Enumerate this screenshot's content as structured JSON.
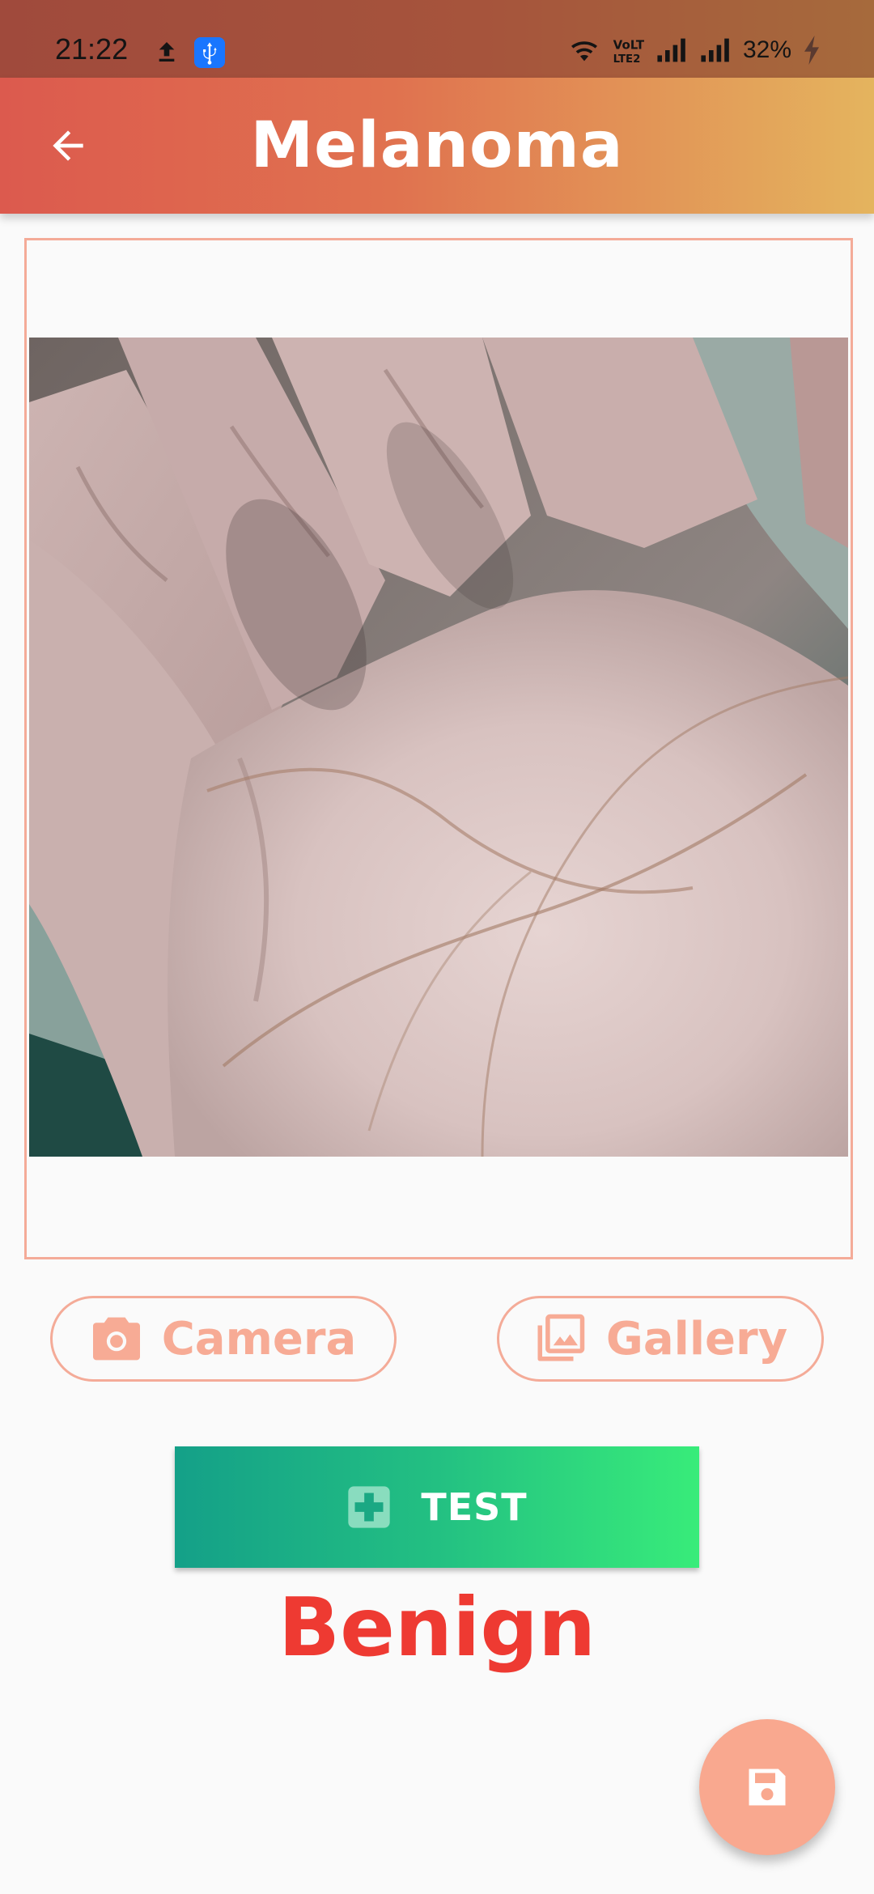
{
  "status_bar": {
    "time": "21:22",
    "battery": "32%",
    "icons": [
      "upload-icon",
      "usb-icon",
      "wifi-icon",
      "volte-icon",
      "signal-icon",
      "signal-icon",
      "charging-icon"
    ]
  },
  "app_bar": {
    "title": "Melanoma",
    "back_icon": "arrow-back-icon"
  },
  "actions": {
    "camera_label": "Camera",
    "gallery_label": "Gallery"
  },
  "test_button": {
    "label": "TEST",
    "icon": "medical-plus-icon"
  },
  "result": {
    "text": "Benign"
  },
  "fab": {
    "icon": "save-icon"
  },
  "colors": {
    "accent": "#f7ab95",
    "result": "#ee3a32",
    "test_start": "#14a088",
    "test_end": "#38ec7a"
  }
}
